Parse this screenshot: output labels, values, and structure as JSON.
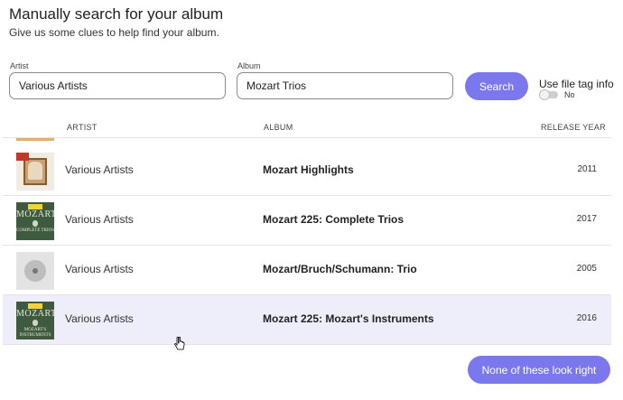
{
  "header": {
    "title": "Manually search for your album",
    "subtitle": "Give us some clues to help find your album."
  },
  "search": {
    "artist_label": "Artist",
    "artist_value": "Various Artists",
    "album_label": "Album",
    "album_value": "Mozart Trios",
    "button_label": "Search",
    "file_tag_label": "Use file tag info",
    "file_tag_state": "No",
    "file_tag_on": false
  },
  "columns": {
    "artist": "ARTIST",
    "album": "ALBUM",
    "year": "RELEASE YEAR"
  },
  "results": [
    {
      "artist": "Various Artists",
      "album": "Mozart Highlights",
      "year": "2011",
      "cover": "mozart-highlights-cover"
    },
    {
      "artist": "Various Artists",
      "album": "Mozart 225: Complete Trios",
      "year": "2017",
      "cover": "mozart-225-complete-trios-cover",
      "cover_title": "MOZART",
      "cover_sub": "COMPLETE TRIOS"
    },
    {
      "artist": "Various Artists",
      "album": "Mozart/Bruch/Schumann: Trio",
      "year": "2005",
      "cover": "generic-disc-cover"
    },
    {
      "artist": "Various Artists",
      "album": "Mozart 225: Mozart's Instruments",
      "year": "2016",
      "cover": "mozart-225-instruments-cover",
      "cover_title": "MOZART",
      "cover_sub": "MOZART'S INSTRUMENTS",
      "highlighted": true
    }
  ],
  "footer": {
    "none_button_label": "None of these look right"
  },
  "colors": {
    "accent": "#7b78ee",
    "row_highlight": "#eeeefa"
  }
}
